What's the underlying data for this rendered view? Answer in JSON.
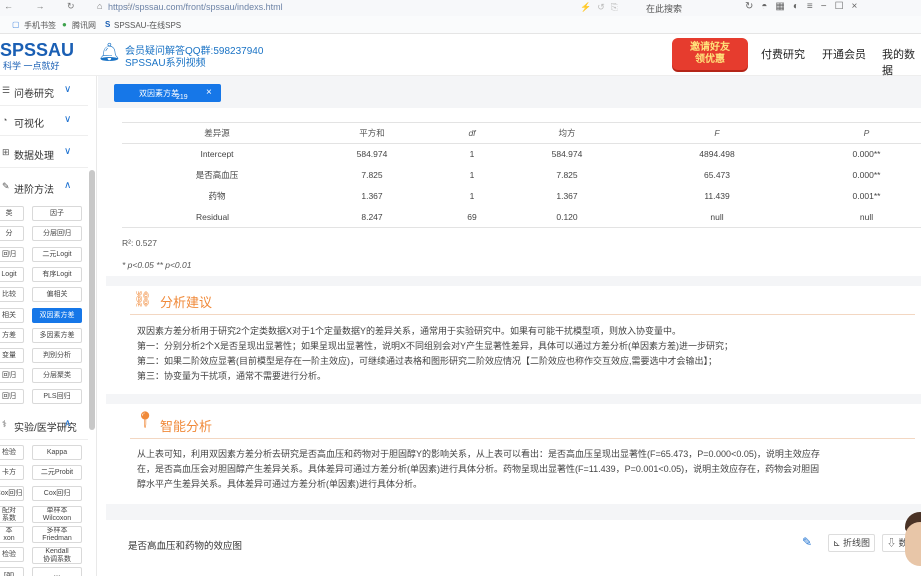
{
  "browser": {
    "url": "https://spssau.com/front/spssau/indexs.html",
    "search_placeholder": "在此搜索",
    "nav": "← → ↻ ⌂ ☆"
  },
  "bookmarks": {
    "items": [
      "手机书签",
      "腾讯网",
      "SPSSAU-在线SPS"
    ]
  },
  "header": {
    "logo": "SPSSAU",
    "slogan": "科学 一点就好",
    "qq": "会员疑问解答QQ群:598237940",
    "video": "SPSSAU系列视频",
    "promo_line1": "邀请好友",
    "promo_line2": "领优惠",
    "nav": [
      "付费研究",
      "开通会员",
      "我的数据"
    ]
  },
  "sidebar": {
    "groups": [
      {
        "label": "问卷研究",
        "icon": "☰"
      },
      {
        "label": "可视化",
        "icon": "◔"
      },
      {
        "label": "数据处理",
        "icon": "⊞"
      },
      {
        "label": "进阶方法",
        "icon": "✎"
      },
      {
        "label": "实验/医学研究",
        "icon": "⚕"
      }
    ],
    "advanced": [
      [
        "类",
        "因子"
      ],
      [
        "分",
        "分层回归"
      ],
      [
        "回归",
        "二元Logit"
      ],
      [
        "Logit",
        "有序Logit"
      ],
      [
        "比较",
        "偏相关"
      ],
      [
        "相关",
        "双因素方差"
      ],
      [
        "方差",
        "多因素方差"
      ],
      [
        "变量",
        "判别分析"
      ],
      [
        "回归",
        "分层聚类"
      ],
      [
        "回归",
        "PLS回归"
      ]
    ],
    "experiment": [
      [
        "检验",
        "Kappa"
      ],
      [
        "卡方",
        "二元Probit"
      ],
      [
        "Cox回归",
        "Cox回归"
      ],
      [
        "配对\n系数",
        "单样本\nWilcoxon"
      ],
      [
        "本\nxon",
        "多样本\nFriedman"
      ],
      [
        "检验",
        "Kendall\n协调系数"
      ],
      [
        "ran",
        "…"
      ]
    ]
  },
  "tab": {
    "label": "双因素方差",
    "num": "219",
    "close": "×"
  },
  "table": {
    "headers": [
      "差异源",
      "平方和",
      "df",
      "均方",
      "F",
      "P"
    ],
    "rows": [
      [
        "Intercept",
        "584.974",
        "1",
        "584.974",
        "4894.498",
        "0.000**"
      ],
      [
        "是否高血压",
        "7.825",
        "1",
        "7.825",
        "65.473",
        "0.000**"
      ],
      [
        "药物",
        "1.367",
        "1",
        "1.367",
        "11.439",
        "0.001**"
      ],
      [
        "Residual",
        "8.247",
        "69",
        "0.120",
        "null",
        "null"
      ]
    ],
    "r2": "R²: 0.527",
    "sig_note": "* p<0.05 ** p<0.01"
  },
  "advice": {
    "title": "分析建议",
    "lines": [
      "双因素方差分析用于研究2个定类数据X对于1个定量数据Y的差异关系，通常用于实验研究中。如果有可能干扰模型项，则放入协变量中。",
      "第一：分别分析2个X是否呈现出显著性；如果呈现出显著性，说明X不同组别会对Y产生显著性差异，具体可以通过方差分析(单因素方差)进一步研究；",
      "第二：如果二阶效应显著(目前模型是存在一阶主效应)，可继续通过表格和图形研究二阶效应情况【二阶效应也称作交互效应,需要选中才会输出】；",
      "第三：协变量为干扰项，通常不需要进行分析。"
    ]
  },
  "smart": {
    "title": "智能分析",
    "lines": [
      "从上表可知，利用双因素方差分析去研究是否高血压和药物对于胆固醇Y的影响关系，从上表可以看出：是否高血压呈现出显著性(F=65.473，P=0.000<0.05)，说明主效应存",
      "在，是否高血压会对胆固醇产生差异关系。具体差异可通过方差分析(单因素)进行具体分析。药物呈现出显著性(F=11.439，P=0.001<0.05)，说明主效应存在，药物会对胆固",
      "醇水平产生差异关系。具体差异可通过方差分析(单因素)进行具体分析。"
    ]
  },
  "footer": {
    "title": "是否高血压和药物的效应图",
    "btn_line": "折线图",
    "btn_data": "数"
  },
  "colors": {
    "accent": "#1677e8",
    "orange": "#f08a3a"
  }
}
